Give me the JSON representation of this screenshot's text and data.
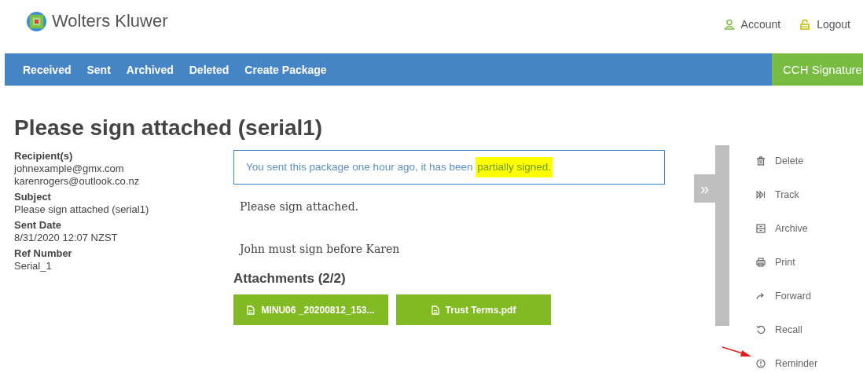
{
  "brand": {
    "name": "Wolters Kluwer"
  },
  "user_links": [
    {
      "label": "Account"
    },
    {
      "label": "Logout"
    }
  ],
  "nav": {
    "items": [
      {
        "label": "Received"
      },
      {
        "label": "Sent"
      },
      {
        "label": "Archived"
      },
      {
        "label": "Deleted"
      },
      {
        "label": "Create Package"
      }
    ],
    "product": "CCH Signature"
  },
  "title": "Please sign attached (serial1)",
  "details": [
    {
      "label": "Recipient(s)",
      "values": [
        "johnexample@gmx.com",
        "karenrogers@outlook.co.nz"
      ]
    },
    {
      "label": "Subject",
      "values": [
        "Please sign attached (serial1)"
      ]
    },
    {
      "label": "Sent Date",
      "values": [
        "8/31/2020 12:07 NZST"
      ]
    },
    {
      "label": "Ref Number",
      "values": [
        "Serial_1"
      ]
    }
  ],
  "status": {
    "text": "You sent this package one hour ago, it has been ",
    "highlight": "partially signed."
  },
  "message": [
    "Please sign attached.",
    "John must sign before Karen"
  ],
  "attachments": {
    "heading": "Attachments (2/2)",
    "files": [
      "MINU06 _20200812_153...",
      "Trust Terms.pdf"
    ]
  },
  "panel_toggle": "»",
  "actions": [
    {
      "label": "Delete"
    },
    {
      "label": "Track"
    },
    {
      "label": "Archive"
    },
    {
      "label": "Print"
    },
    {
      "label": "Forward"
    },
    {
      "label": "Recall"
    },
    {
      "label": "Reminder"
    }
  ]
}
